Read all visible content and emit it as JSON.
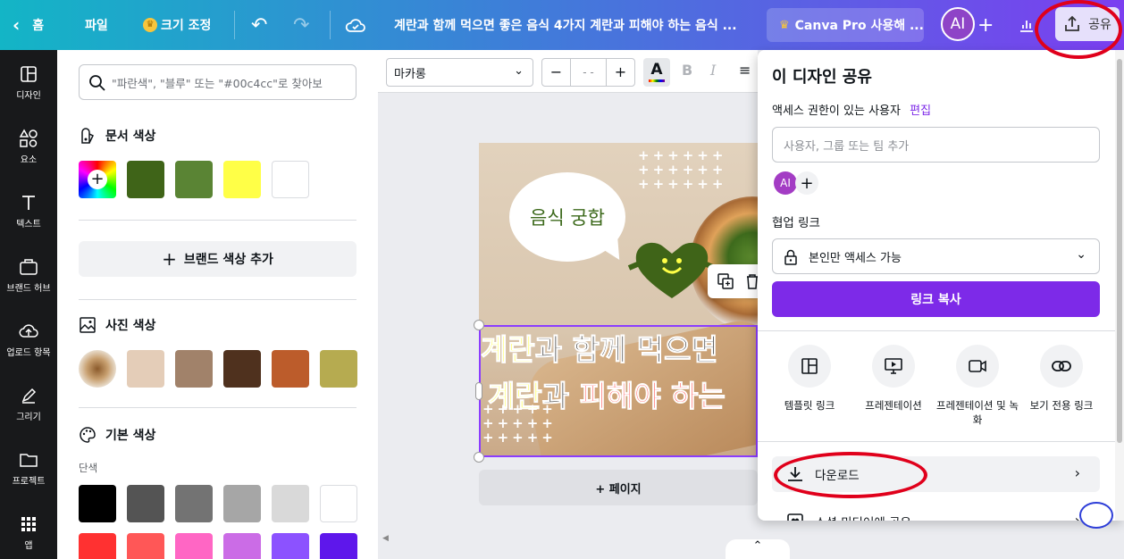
{
  "topbar": {
    "home_label": "홈",
    "file_label": "파일",
    "resize_label": "크기 조정",
    "doc_title": "계란과 함께 먹으면 좋은 음식 4가지 계란과 피해야 하는 음식 ...",
    "pro_label": "Canva Pro 사용해 ...",
    "avatar_initials": "AI",
    "share_label": "공유"
  },
  "rail": {
    "items": [
      {
        "label": "디자인",
        "icon": "layout-icon"
      },
      {
        "label": "요소",
        "icon": "shapes-icon"
      },
      {
        "label": "텍스트",
        "icon": "text-icon"
      },
      {
        "label": "브랜드 허브",
        "icon": "brand-icon"
      },
      {
        "label": "업로드 항목",
        "icon": "upload-icon"
      },
      {
        "label": "그리기",
        "icon": "draw-icon"
      },
      {
        "label": "프로젝트",
        "icon": "folder-icon"
      },
      {
        "label": "앱",
        "icon": "apps-icon"
      }
    ]
  },
  "color_panel": {
    "search_placeholder": "\"파란색\", \"블루\" 또는 \"#00c4cc\"로 찾아보",
    "doc_colors_title": "문서 색상",
    "doc_colors": [
      "#3f6418",
      "#5a8434",
      "#ffff47",
      "#ffffff"
    ],
    "brand_add_label": "브랜드 색상 추가",
    "photo_colors_title": "사진 색상",
    "photo_colors": [
      "#e4cdb8",
      "#a1826a",
      "#4f311e",
      "#bc5c2b",
      "#b6ab50"
    ],
    "default_colors_title": "기본 색상",
    "solid_label": "단색",
    "solid_row1": [
      "#000000",
      "#545454",
      "#737373",
      "#a6a6a6",
      "#d9d9d9",
      "#ffffff"
    ],
    "solid_row2": [
      "#ff3131",
      "#ff5757",
      "#ff66c4",
      "#cb6ce6",
      "#8c52ff",
      "#5e17eb"
    ]
  },
  "toolbar": {
    "font_name": "마카롱",
    "size_placeholder": "- -",
    "minus": "−",
    "plus": "+"
  },
  "design": {
    "bubble_text": "음식 궁합",
    "line1_highlight": "계란",
    "line1_rest": "과 함께 먹으면",
    "line2_highlight": "계란",
    "line2_mid": "과 ",
    "line2_red": "피해야 하는"
  },
  "canvas": {
    "add_page_label": "+ 페이지"
  },
  "share": {
    "title": "이 디자인 공유",
    "access_label": "액세스 권한이 있는 사용자",
    "edit_link": "편집",
    "input_placeholder": "사용자, 그룹 또는 팀 추가",
    "user_initials": "AI",
    "collab_label": "협업 링크",
    "access_value": "본인만 액세스 가능",
    "copy_link_label": "링크 복사",
    "options": [
      {
        "label": "템플릿 링크",
        "icon": "template-icon"
      },
      {
        "label": "프레젠테이션",
        "icon": "present-icon"
      },
      {
        "label": "프레젠테이션 및 녹화",
        "icon": "record-icon"
      },
      {
        "label": "보기 전용 링크",
        "icon": "link-icon"
      }
    ],
    "download_label": "다운로드",
    "social_label": "소셜 미디어에 공유"
  },
  "colors": {
    "accent_purple": "#7d2ae8",
    "annotation_red": "#e0001b"
  }
}
